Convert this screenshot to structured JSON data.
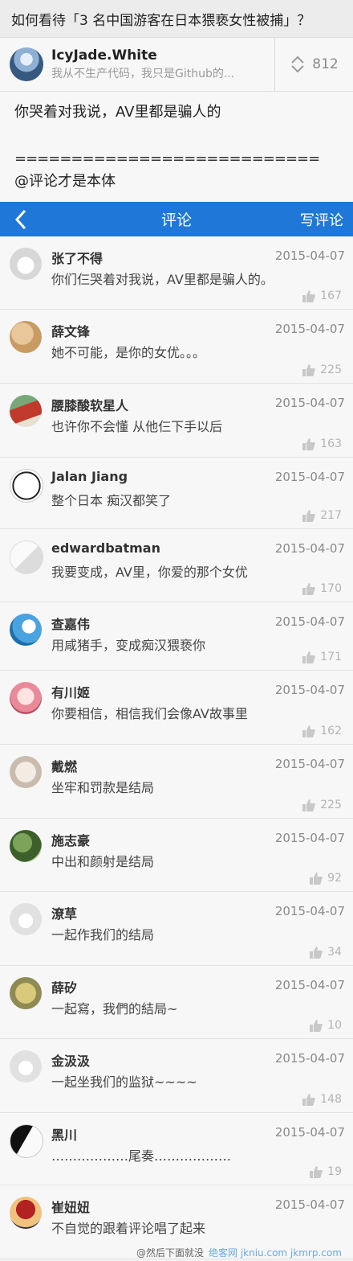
{
  "question": {
    "title": "如何看待「3 名中国游客在日本猥亵女性被捕」？"
  },
  "answer": {
    "author_name": "IcyJade.White",
    "author_bio": "我从不生产代码，我只是Github的...",
    "votes": "812",
    "body_line1": "你哭着对我说，AV里都是骗人的",
    "body_line2": "===========================",
    "body_line3": "@评论才是本体"
  },
  "nav": {
    "back_icon": "chevron-left-icon",
    "title": "评论",
    "write_label": "写评论",
    "color": "#1f78d8"
  },
  "comments": [
    {
      "name": "张了不得",
      "date": "2015-04-07",
      "text": "你们仨哭着对我说，AV里都是骗人的。",
      "likes": "167"
    },
    {
      "name": "薛文锋",
      "date": "2015-04-07",
      "text": "她不可能，是你的女优。。。",
      "likes": "225"
    },
    {
      "name": "腰膝酸软星人",
      "date": "2015-04-07",
      "text": "也许你不会懂 从他仨下手以后",
      "likes": "163"
    },
    {
      "name": "Jalan Jiang",
      "date": "2015-04-07",
      "text": "整个日本 痴汉都笑了",
      "likes": "217"
    },
    {
      "name": "edwardbatman",
      "date": "2015-04-07",
      "text": "我要变成，AV里，你爱的那个女优",
      "likes": "170"
    },
    {
      "name": "查嘉伟",
      "date": "2015-04-07",
      "text": "用咸猪手，变成痴汉猥亵你",
      "likes": "171"
    },
    {
      "name": "有川姬",
      "date": "2015-04-07",
      "text": "你要相信，相信我们会像AV故事里",
      "likes": "162"
    },
    {
      "name": "戴燃",
      "date": "2015-04-07",
      "text": "坐牢和罚款是结局",
      "likes": "225"
    },
    {
      "name": "施志豪",
      "date": "2015-04-07",
      "text": "中出和颜射是结局",
      "likes": "92"
    },
    {
      "name": "潦草",
      "date": "2015-04-07",
      "text": "一起作我们的结局",
      "likes": "34"
    },
    {
      "name": "薛矽",
      "date": "2015-04-07",
      "text": "一起寫，我們的結局~",
      "likes": "10"
    },
    {
      "name": "金汲汲",
      "date": "2015-04-07",
      "text": "一起坐我们的监狱~~~~",
      "likes": "148"
    },
    {
      "name": "黑川",
      "date": "2015-04-07",
      "text": "………………尾奏………………",
      "likes": "19"
    },
    {
      "name": "崔妞妞",
      "date": "2015-04-07",
      "text": "不自觉的跟着评论唱了起来",
      "likes": ""
    }
  ],
  "footer": {
    "caption": "@然后下面就没",
    "watermark": "绝客网 jkniu.com jkmrp.com"
  }
}
